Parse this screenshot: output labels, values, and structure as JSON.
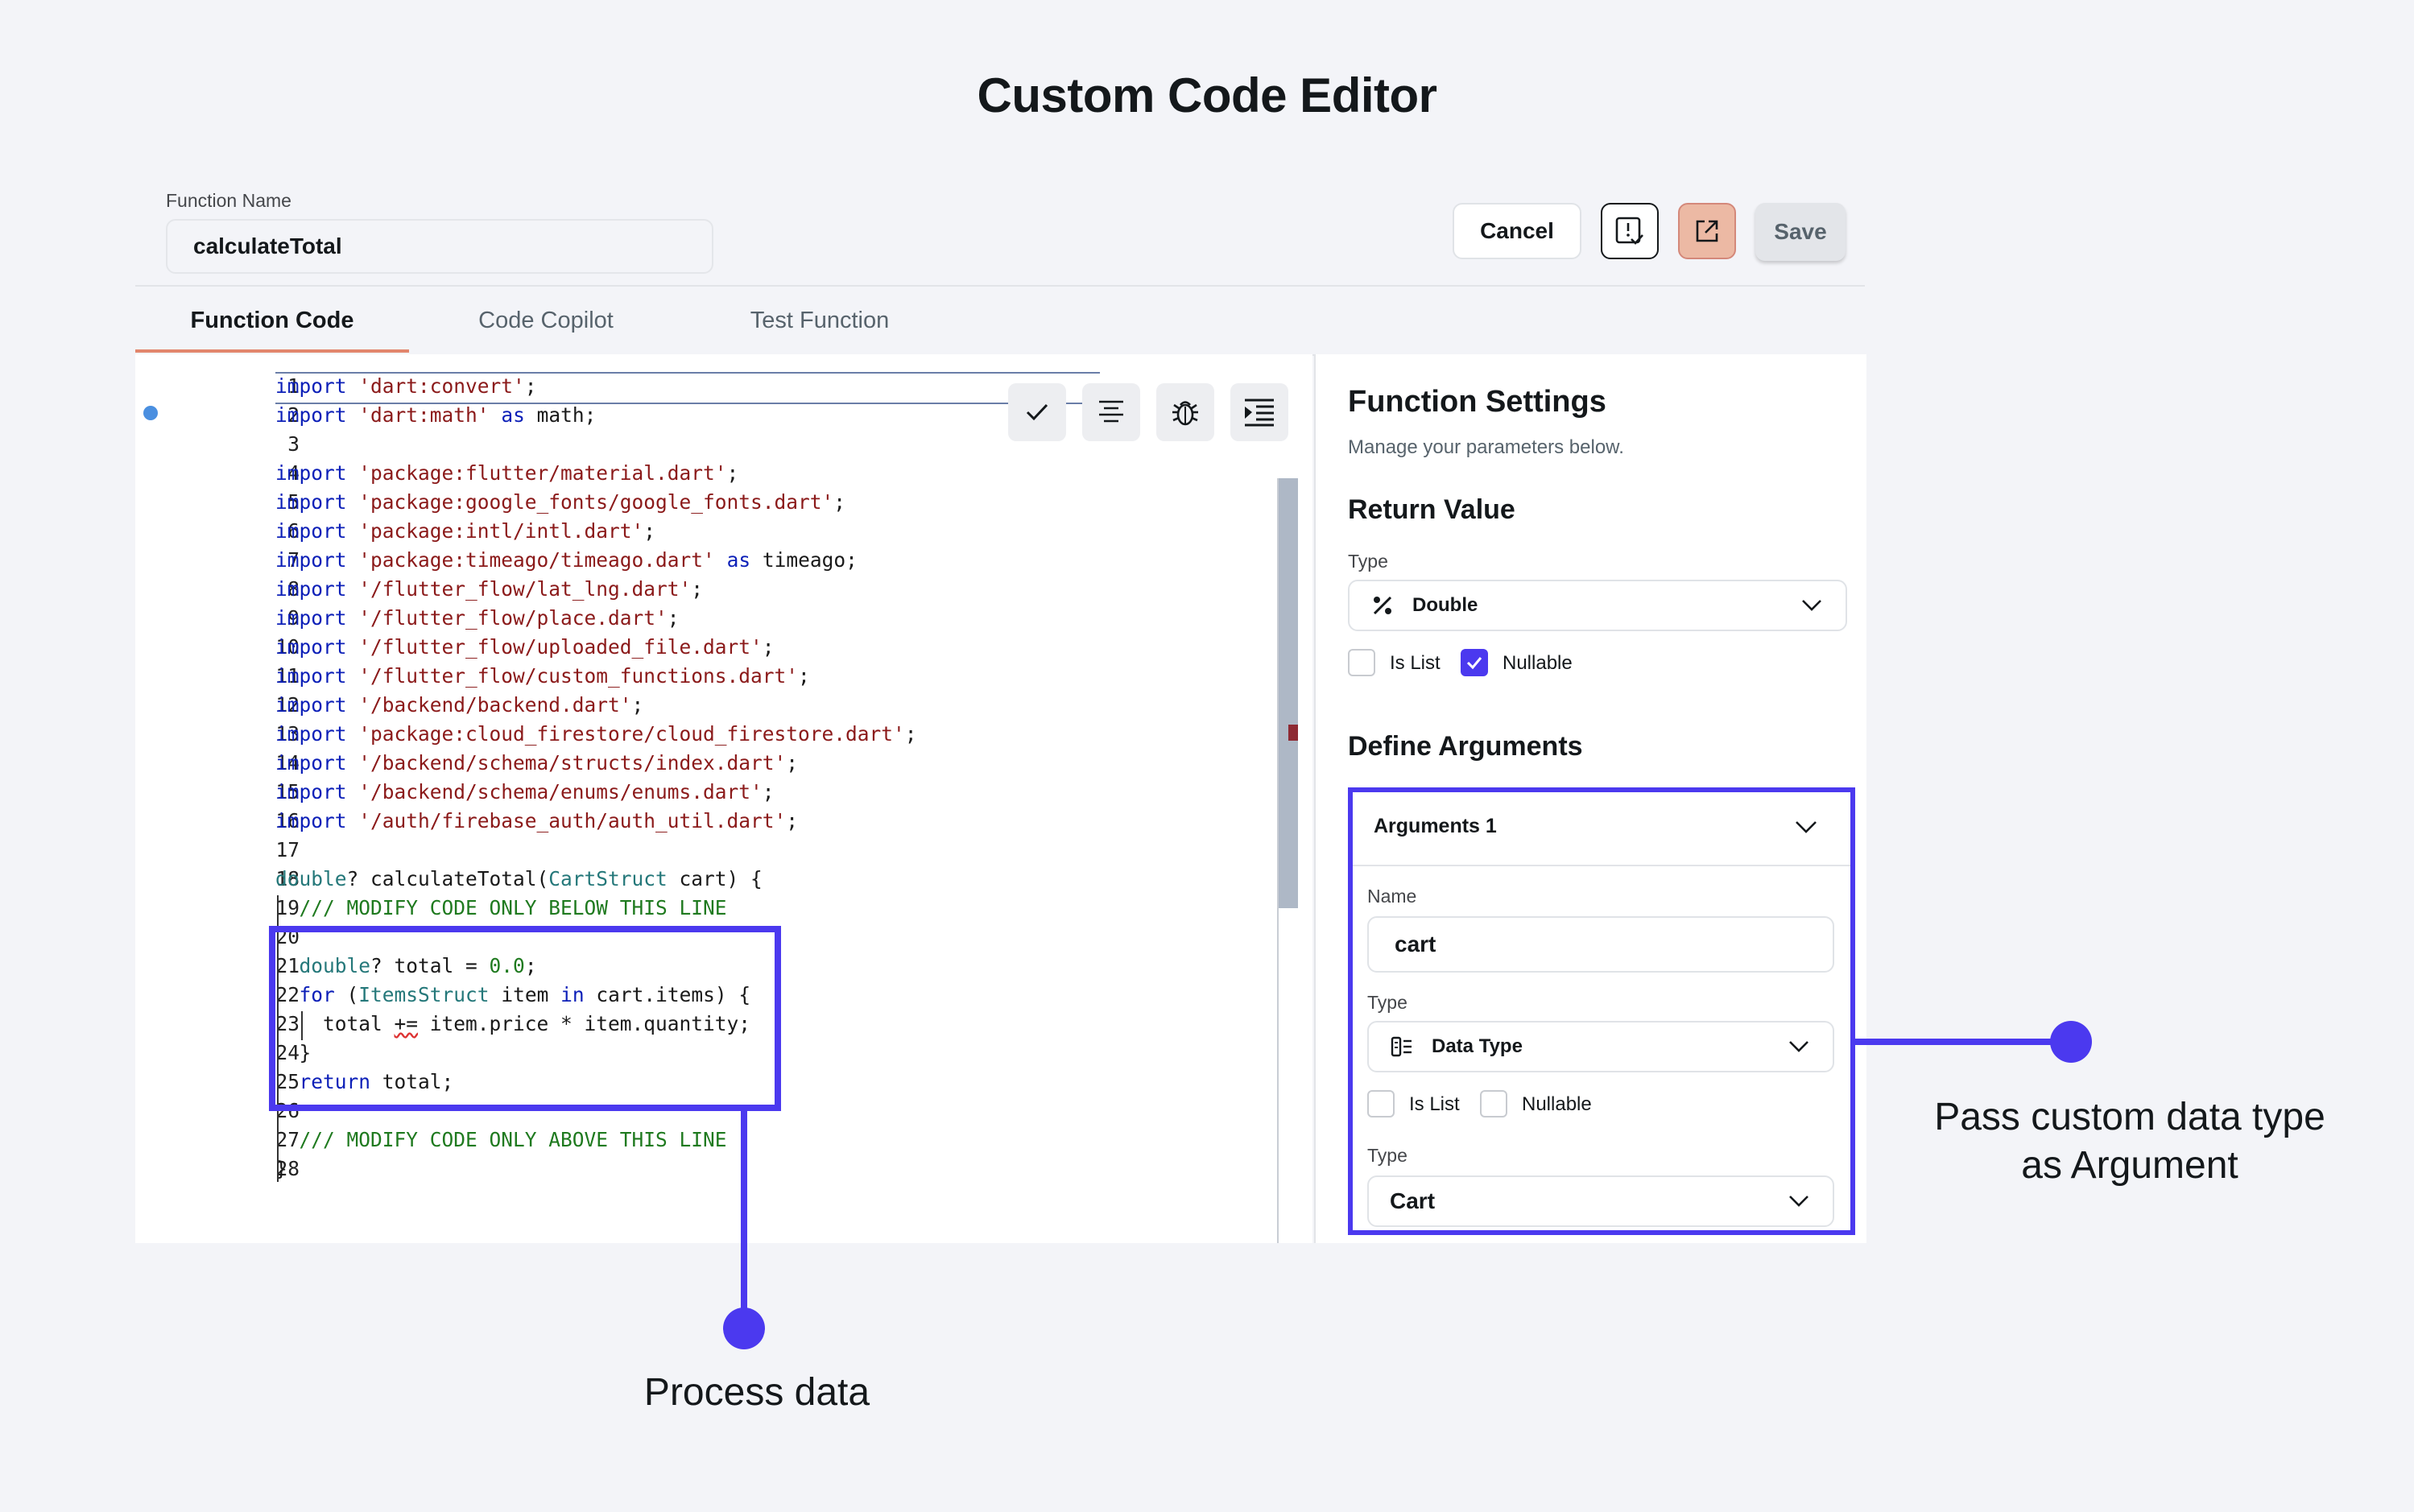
{
  "page_title": "Custom Code Editor",
  "header": {
    "function_name_label": "Function Name",
    "function_name_value": "calculateTotal",
    "cancel_label": "Cancel",
    "save_label": "Save"
  },
  "tabs": [
    {
      "label": "Function Code",
      "active": true
    },
    {
      "label": "Code Copilot",
      "active": false
    },
    {
      "label": "Test Function",
      "active": false
    }
  ],
  "code": {
    "line_numbers": [
      "1",
      "2",
      "3",
      "4",
      "5",
      "6",
      "7",
      "8",
      "9",
      "10",
      "11",
      "12",
      "13",
      "14",
      "15",
      "16",
      "17",
      "18",
      "19",
      "20",
      "21",
      "22",
      "23",
      "24",
      "25",
      "26",
      "27",
      "28"
    ]
  },
  "settings": {
    "title": "Function Settings",
    "subtitle": "Manage your parameters below.",
    "return_value_heading": "Return Value",
    "type_label": "Type",
    "return_type": "Double",
    "is_list_label": "Is List",
    "nullable_label": "Nullable",
    "return_is_list": false,
    "return_nullable": true,
    "define_arguments_heading": "Define Arguments",
    "argument": {
      "header": "Arguments 1",
      "name_label": "Name",
      "name_value": "cart",
      "type_label": "Type",
      "type_value": "Data Type",
      "is_list_label": "Is List",
      "nullable_label": "Nullable",
      "is_list": false,
      "nullable": false,
      "subtype_label": "Type",
      "subtype_value": "Cart"
    }
  },
  "annotations": {
    "process_data": "Process data",
    "pass_custom_line1": "Pass custom data type",
    "pass_custom_line2": "as Argument"
  },
  "colors": {
    "accent": "#4b39ef",
    "tab_underline": "#e2866d",
    "export_button": "#ecb9a4"
  }
}
